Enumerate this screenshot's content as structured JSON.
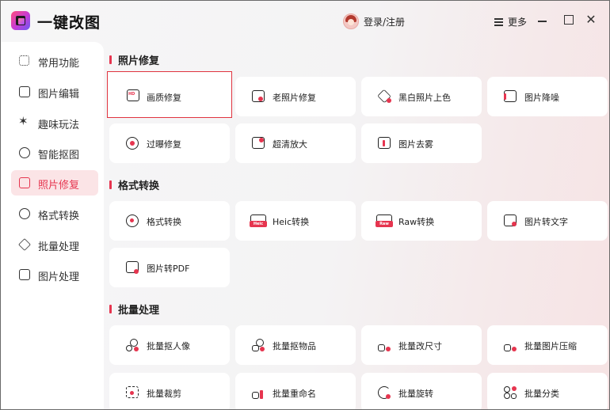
{
  "app": {
    "title": "一键改图"
  },
  "header": {
    "login": "登录/注册",
    "more": "更多"
  },
  "sidebar": {
    "items": [
      {
        "label": "常用功能",
        "icon": "grid-icon"
      },
      {
        "label": "图片编辑",
        "icon": "edit-icon"
      },
      {
        "label": "趣味玩法",
        "icon": "sparkle-icon"
      },
      {
        "label": "智能抠图",
        "icon": "target-icon"
      },
      {
        "label": "照片修复",
        "icon": "photo-repair-icon",
        "active": true
      },
      {
        "label": "格式转换",
        "icon": "convert-icon"
      },
      {
        "label": "批量处理",
        "icon": "layers-icon"
      },
      {
        "label": "图片处理",
        "icon": "image-icon"
      }
    ]
  },
  "sections": {
    "photo_repair": {
      "title": "照片修复",
      "cards": [
        {
          "label": "画质修复"
        },
        {
          "label": "老照片修复"
        },
        {
          "label": "黑白照片上色"
        },
        {
          "label": "图片降噪"
        },
        {
          "label": "过曝修复"
        },
        {
          "label": "超清放大"
        },
        {
          "label": "图片去雾"
        }
      ]
    },
    "format": {
      "title": "格式转换",
      "cards": [
        {
          "label": "格式转换"
        },
        {
          "label": "Heic转换",
          "badge": "Heic"
        },
        {
          "label": "Raw转换",
          "badge": "Raw"
        },
        {
          "label": "图片转文字"
        },
        {
          "label": "图片转PDF"
        }
      ]
    },
    "batch": {
      "title": "批量处理",
      "cards": [
        {
          "label": "批量抠人像"
        },
        {
          "label": "批量抠物品"
        },
        {
          "label": "批量改尺寸"
        },
        {
          "label": "批量图片压缩"
        },
        {
          "label": "批量裁剪"
        },
        {
          "label": "批量重命名"
        },
        {
          "label": "批量旋转"
        },
        {
          "label": "批量分类"
        }
      ]
    }
  },
  "colors": {
    "accent": "#e6354f",
    "active_bg": "#fbe4e6",
    "selected_border": "#e0343f"
  }
}
